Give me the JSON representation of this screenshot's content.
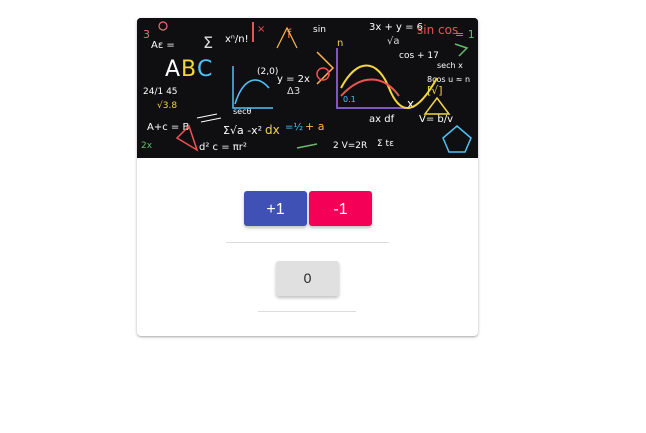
{
  "banner": {
    "image_name": "math-chalkboard-doodles"
  },
  "controls": {
    "increment_label": "+1",
    "decrement_label": "-1"
  },
  "counter": {
    "value": "0"
  },
  "colors": {
    "primary": "#3f51b5",
    "secondary": "#f50057",
    "counter_bg": "#e0e0e0",
    "banner_bg": "#0f0f12"
  }
}
